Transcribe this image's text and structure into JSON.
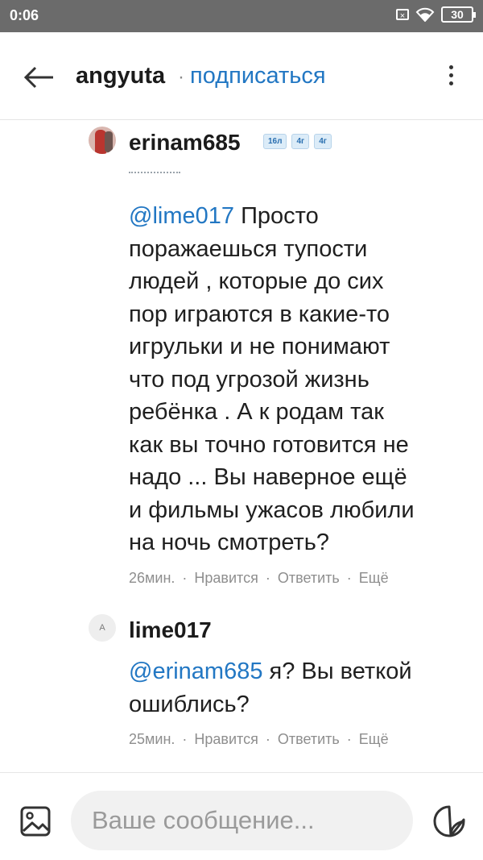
{
  "status_bar": {
    "time": "0:06",
    "battery": "30",
    "x_icon": "x-box-icon",
    "wifi_icon": "wifi-icon"
  },
  "header": {
    "username": "angyuta",
    "separator": "·",
    "subscribe": "подписаться"
  },
  "comments": [
    {
      "author": "erinam685",
      "badges": [
        "16л",
        "4г",
        "4г"
      ],
      "mention": "@lime017",
      "text_lines": [
        "Просто",
        "поражаешься тупости",
        "людей , которые до сих",
        "пор играются в какие-то",
        "игрульки и не понимают",
        "что под угрозой жизнь",
        "ребёнка . А к родам так",
        "как вы точно готовится не",
        "надо ... Вы наверное ещё",
        "и фильмы ужасов любили",
        "на ночь смотреть?"
      ],
      "time": "26мин.",
      "like": "Нравится",
      "reply": "Ответить",
      "more": "Ещё"
    },
    {
      "author": "lime017",
      "avatar_letter": "A",
      "mention": "@erinam685",
      "text_first": "я? Вы веткой",
      "text_lines": [
        "ошиблись?"
      ],
      "time": "25мин.",
      "like": "Нравится",
      "reply": "Ответить",
      "more": "Ещё"
    }
  ],
  "actions_separator": "·",
  "composer": {
    "placeholder": "Ваше сообщение..."
  },
  "colors": {
    "link": "#2277c3",
    "status_bar": "#6b6b6b",
    "meta": "#8e8e8e"
  }
}
